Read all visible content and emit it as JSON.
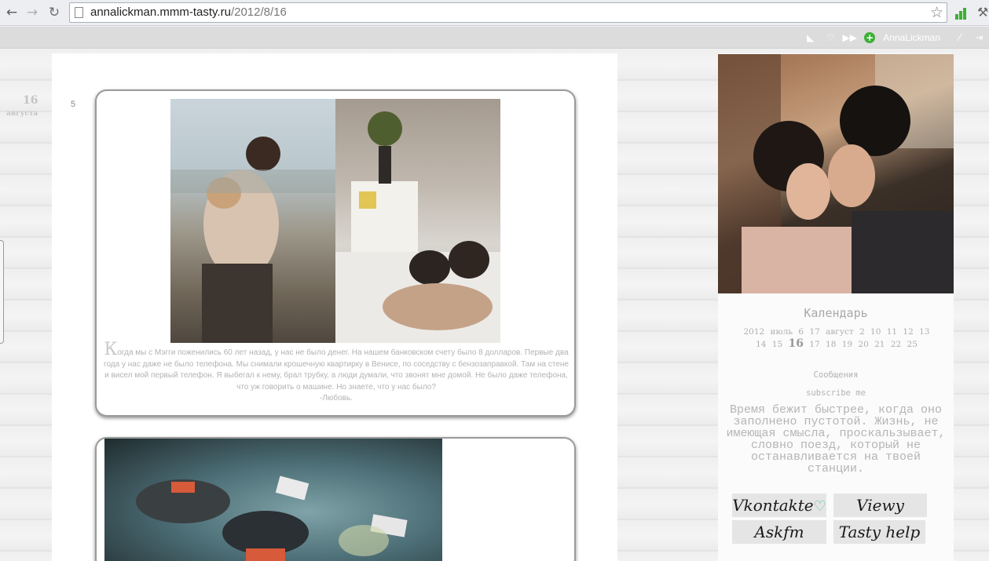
{
  "browser": {
    "url_domain": "annalickman.mmm-tasty.ru",
    "url_path": "/2012/8/16",
    "back_icon": "back-arrow-icon",
    "forward_icon": "forward-arrow-icon",
    "reload_icon": "reload-icon",
    "bookmark_icon": "star-icon"
  },
  "site_bar": {
    "username": "AnnaLickman",
    "icons": [
      "rss-icon",
      "heart-icon",
      "fast-forward-icon",
      "add-icon",
      "settings-icon",
      "logout-icon"
    ]
  },
  "date": {
    "day": "16",
    "month": "августа"
  },
  "posts": [
    {
      "number": "5",
      "text_first_letter": "К",
      "text_rest": "огда мы с Мэгги поженились 60 лет назад, у нас не было денег. На нашем банковском счету было 8 долларов. Первые два года у нас даже не было телефона. Мы снимали крошечную квартирку в Венисе, по соседству с бензозаправкой. Там на стене и висел мой первый телефон. Я выбегал к нему, брал трубку, а люди думали, что звонят мне домой. Не было даже телефона, что уж говорить о машине. Но знаете, что у нас было?",
      "text_sign": "-Любовь."
    }
  ],
  "sidebar": {
    "calendar_title": "Календарь",
    "calendar_line1": "2012 июль 6 17 август 2 10 11 12 13",
    "calendar_line2_a": "14 15",
    "calendar_current": "16",
    "calendar_line2_b": "17 18 19 20 21 22 25",
    "messages_label": "Сообщения",
    "subscribe_label": "subscribe me",
    "quote": "Время бежит быстрее, когда оно заполнено пустотой. Жизнь, не имеющая смысла, проскальзывает, словно поезд, который не останавливается на твоей станции.",
    "links": [
      "Vkontakte",
      "Viewy",
      "Askfm",
      "Tasty help"
    ]
  },
  "colors": {
    "success_green": "#3cb034",
    "text_gray": "#b3b3b3"
  }
}
